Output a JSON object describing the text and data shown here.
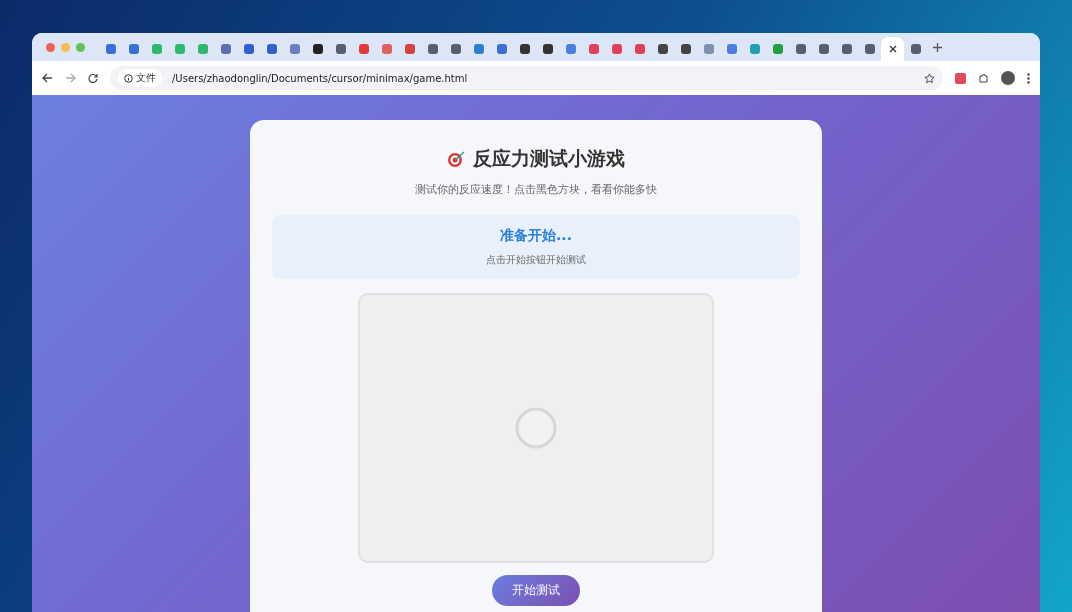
{
  "browser": {
    "tabs": [
      {
        "color": "#3b6fd8",
        "selected": false
      },
      {
        "color": "#3b6fd8",
        "selected": false
      },
      {
        "color": "#2fb86b",
        "selected": false
      },
      {
        "color": "#2fb86b",
        "selected": false
      },
      {
        "color": "#2fb86b",
        "selected": false
      },
      {
        "color": "#5a6fb0",
        "selected": false
      },
      {
        "color": "#2f5fd0",
        "selected": false
      },
      {
        "color": "#2f5fd0",
        "selected": false
      },
      {
        "color": "#6a7fc0",
        "selected": false
      },
      {
        "color": "#222222",
        "selected": false
      },
      {
        "color": "#555f70",
        "selected": false
      },
      {
        "color": "#e03a3a",
        "selected": false
      },
      {
        "color": "#e06060",
        "selected": false
      },
      {
        "color": "#d84040",
        "selected": false
      },
      {
        "color": "#555f70",
        "selected": false
      },
      {
        "color": "#555f70",
        "selected": false
      },
      {
        "color": "#2a7fd0",
        "selected": false
      },
      {
        "color": "#3b6fd8",
        "selected": false
      },
      {
        "color": "#333333",
        "selected": false
      },
      {
        "color": "#333333",
        "selected": false
      },
      {
        "color": "#4a7fe0",
        "selected": false
      },
      {
        "color": "#e0405a",
        "selected": false
      },
      {
        "color": "#e0405a",
        "selected": false
      },
      {
        "color": "#e0405a",
        "selected": false
      },
      {
        "color": "#444444",
        "selected": false
      },
      {
        "color": "#444444",
        "selected": false
      },
      {
        "color": "#8090b0",
        "selected": false
      },
      {
        "color": "#4a7fe0",
        "selected": false
      },
      {
        "color": "#20a0b0",
        "selected": false
      },
      {
        "color": "#22a040",
        "selected": false
      },
      {
        "color": "#555f70",
        "selected": false
      },
      {
        "color": "#555f70",
        "selected": false
      },
      {
        "color": "#555f70",
        "selected": false
      },
      {
        "color": "#555f70",
        "selected": false
      },
      {
        "selected": true
      },
      {
        "color": "#555f70",
        "selected": false
      }
    ],
    "security_chip": "文件",
    "url": "/Users/zhaodonglin/Documents/cursor/minimax/game.html"
  },
  "game": {
    "title": "反应力测试小游戏",
    "subtitle": "测试你的反应速度！点击黑色方块，看看你能多快",
    "status": {
      "heading": "准备开始...",
      "hint": "点击开始按钮开始测试"
    },
    "start_button": "开始测试"
  }
}
